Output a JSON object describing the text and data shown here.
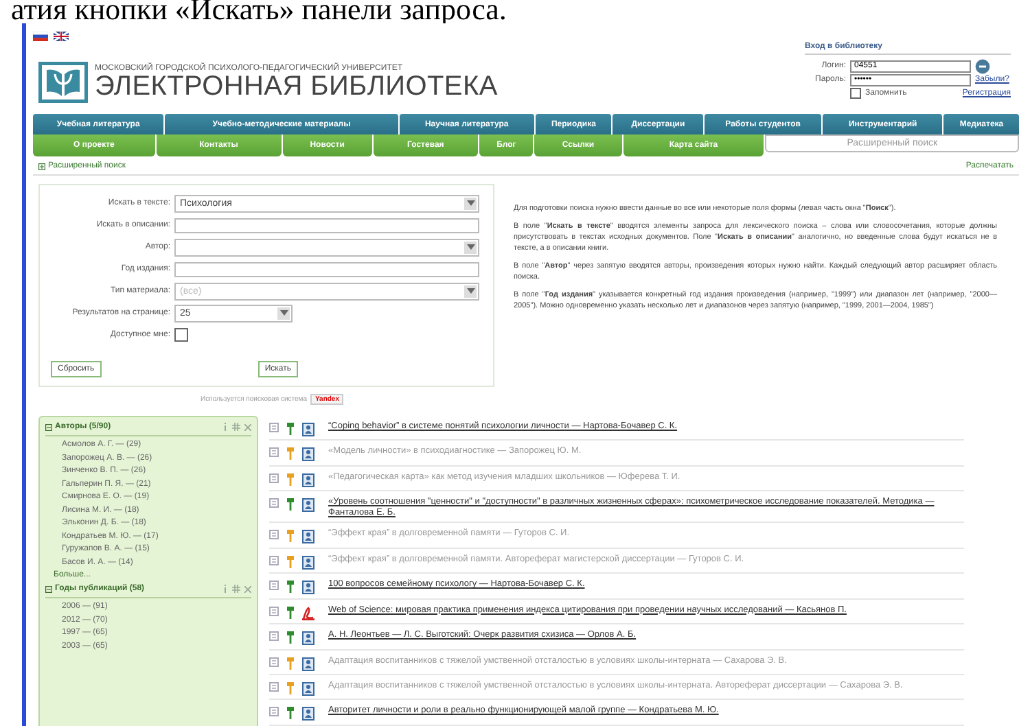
{
  "caption": "атия кнопки «Искать» панели запроса.",
  "header": {
    "university": "МОСКОВСКИЙ ГОРОДСКОЙ ПСИХОЛОГО-ПЕДАГОГИЧЕСКИЙ УНИВЕРСИТЕТ",
    "title": "ЭЛЕКТРОННАЯ БИБЛИОТЕКА"
  },
  "login": {
    "title": "Вход в библиотеку",
    "login_label": "Логин:",
    "login_value": "04551",
    "password_label": "Пароль:",
    "password_value": "••••••",
    "forgot": "Забыли?",
    "remember": {
      "label": "Запомнить",
      "checked": false
    },
    "register": "Регистрация"
  },
  "main_nav": [
    "Учебная литература",
    "Учебно-методические материалы",
    "Научная литература",
    "Периодика",
    "Диссертации",
    "Работы студентов",
    "Инструментарий",
    "Медиатека"
  ],
  "sub_nav": [
    {
      "label": "О проекте",
      "selected": false
    },
    {
      "label": "Контакты",
      "selected": false
    },
    {
      "label": "Новости",
      "selected": false
    },
    {
      "label": "Гостевая",
      "selected": false
    },
    {
      "label": "Блог",
      "selected": false
    },
    {
      "label": "Ссылки",
      "selected": false
    },
    {
      "label": "Карта сайта",
      "selected": false
    },
    {
      "label": "Расширенный поиск",
      "selected": true
    }
  ],
  "section": {
    "title": "Расширенный поиск",
    "print": "Распечатать"
  },
  "form": {
    "fields": [
      {
        "label": "Искать в тексте:",
        "kind": "select",
        "value": "Психология"
      },
      {
        "label": "Искать в описании:",
        "kind": "text"
      },
      {
        "label": "Автор:",
        "kind": "select"
      },
      {
        "label": "Год издания:",
        "kind": "text"
      },
      {
        "label": "Тип материала:",
        "kind": "select",
        "placeholder": "(все)"
      },
      {
        "label": "Результатов на странице:",
        "kind": "short-select",
        "value": "25"
      },
      {
        "label": "Доступное мне:",
        "kind": "checkbox",
        "checked": false
      }
    ],
    "reset": "Сбросить",
    "submit": "Искать"
  },
  "help": [
    "Для подготовки поиска нужно ввести данные во все или некоторые поля формы (левая часть окна \"**Поиск**\").",
    "В поле \"**Искать в тексте**\" вводятся элементы запроса для лексического поиска – слова или словосочетания, которые должны присутствовать в текстах исходных документов. Поле \"**Искать в описании**\" аналогично, но введенные слова будут искаться не в тексте, а в описании книги.",
    "В поле \"**Автор**\" через запятую вводятся авторы, произведения которых нужно найти. Каждый следующий автор расширяет область поиска.",
    "В поле \"**Год издания**\" указывается конкретный год издания произведения (например, \"1999\") или диапазон лет (например, \"2000—2005\"). Можно одновременно указать несколько лет и диапазонов через запятую (например, \"1999, 2001—2004, 1985\")"
  ],
  "engine": {
    "label": "Используется поисковая система",
    "badge": "Yandex"
  },
  "facets": [
    {
      "title": "Авторы (5/90)",
      "items": [
        "Асмолов А. Г. — (29)",
        "Запорожец А. В. — (26)",
        "Зинченко В. П. — (26)",
        "Гальперин П. Я. — (21)",
        "Смирнова Е. О. — (19)",
        "Лисина М. И. — (18)",
        "Эльконин Д. Б. — (18)",
        "Кондратьев М. Ю. — (17)",
        "Гуружапов В. А. — (15)",
        "Басов И. А. — (14)"
      ],
      "more": "Больше..."
    },
    {
      "title": "Годы публикаций (58)",
      "items": [
        "2006 — (91)",
        "2012 — (70)",
        "1997 — (65)",
        "2003 — (65)"
      ]
    }
  ],
  "results": [
    {
      "title": "“Coping behavior” в системе понятий психологии личности — Нартова-Бочавер С. К.",
      "available": true,
      "kind": "doc"
    },
    {
      "title": "«Модель личности» в психодиагностике — Запорожец Ю. М.",
      "available": false,
      "kind": "doc"
    },
    {
      "title": "«Педагогическая карта» как метод изучения младших школьников — Юферева Т. И.",
      "available": false,
      "kind": "doc"
    },
    {
      "title": "«Уровень соотношения \"ценности\" и \"доступности\" в различных жизненных сферах»: психометрическое исследование показателей. Методика — Фанталова Е. Б.",
      "available": true,
      "kind": "doc"
    },
    {
      "title": "“Эффект края” в долговременной памяти — Гуторов С. И.",
      "available": false,
      "kind": "doc"
    },
    {
      "title": "“Эффект края” в долговременной памяти. Автореферат магистерской диссертации — Гуторов С. И.",
      "available": false,
      "kind": "doc"
    },
    {
      "title": "100 вопросов семейному психологу — Нартова-Бочавер С. К.",
      "available": true,
      "kind": "doc"
    },
    {
      "title": "Web of Science: мировая практика применения индекса цитирования при проведении научных исследований — Касьянов П.",
      "available": true,
      "kind": "pdf"
    },
    {
      "title": "А. Н. Леонтьев — Л. С. Выготский: Очерк развития схизиса — Орлов А. Б.",
      "available": true,
      "kind": "doc"
    },
    {
      "title": "Адаптация воспитанников с тяжелой умственной отсталостью в условиях школы-интерната — Сахарова Э. В.",
      "available": false,
      "kind": "doc"
    },
    {
      "title": "Адаптация воспитанников с тяжелой умственной отсталостью в условиях школы-интерната. Автореферат диссертации — Сахарова Э. В.",
      "available": false,
      "kind": "doc"
    },
    {
      "title": "Авторитет личности и роли в реально функционирующей малой группе — Кондратьева М. Ю.",
      "available": true,
      "kind": "doc"
    }
  ]
}
